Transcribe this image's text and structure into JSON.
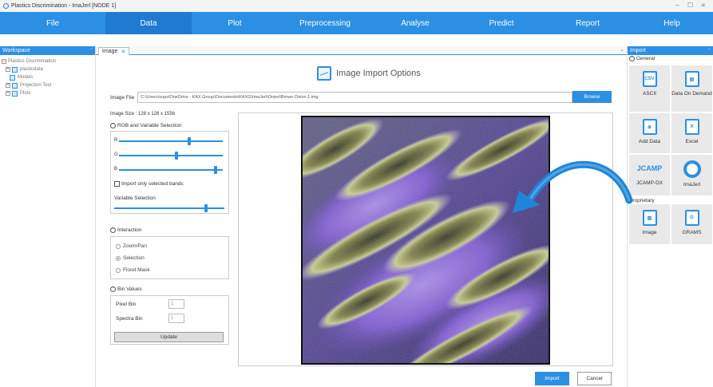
{
  "window": {
    "title": "Plastics Discrimination - ImaJerl [NODE 1]",
    "controls": "– ☐ ≡"
  },
  "menu": [
    {
      "label": "File",
      "active": false
    },
    {
      "label": "Data",
      "active": true
    },
    {
      "label": "Plot",
      "active": false
    },
    {
      "label": "Preprocessing",
      "active": false
    },
    {
      "label": "Analyse",
      "active": false
    },
    {
      "label": "Predict",
      "active": false
    },
    {
      "label": "Report",
      "active": false
    },
    {
      "label": "Help",
      "active": false
    }
  ],
  "workspace": {
    "title": "Workspace",
    "pin": "–",
    "tree": [
      {
        "label": "Plastics Discrimination",
        "expander": "–",
        "indent": 0
      },
      {
        "label": "plasticdata",
        "expander": "+",
        "indent": 1
      },
      {
        "label": "Models",
        "expander": "",
        "indent": 2
      },
      {
        "label": "Projection Test",
        "expander": "+",
        "indent": 1
      },
      {
        "label": "Plots",
        "expander": "+",
        "indent": 1
      }
    ]
  },
  "tab": {
    "label": "Image",
    "close": "✕",
    "chevron": "⌄"
  },
  "dialog": {
    "title": "Image Import Options",
    "file_label": "Image File",
    "file_path": "C:\\Users\\sups\\OneDrive - KAX Group\\Documents\\KAXG\\ImaJerl\\Onion\\Brown Onion.1.img",
    "browse_label": "Browse",
    "image_size": "Image Size : 128 x 128 x 1556",
    "rgb_section": "RGB and Variable Selection",
    "sliders": [
      {
        "label": "R",
        "value": 0.68
      },
      {
        "label": "G",
        "value": 0.55
      },
      {
        "label": "B",
        "value": 0.93
      }
    ],
    "only_selected_label": "Import only selected bands",
    "variable_selection_label": "Variable Selection",
    "variable_value": 0.83,
    "interaction_section": "Interaction",
    "interaction_options": [
      {
        "label": "Zoom/Pan",
        "selected": false
      },
      {
        "label": "Selection",
        "selected": true
      },
      {
        "label": "Flood Mask",
        "selected": false
      }
    ],
    "bin_section": "Bin Values",
    "pixel_bin_label": "Pixel Bin",
    "pixel_bin_value": "1",
    "spectra_bin_label": "Spectra Bin",
    "spectra_bin_value": "1",
    "update_label": "Update",
    "import_label": "Import",
    "cancel_label": "Cancel"
  },
  "import_panel": {
    "title": "Import",
    "pin": "–",
    "general_label": "General",
    "proprietary_label": "Proprietary",
    "general_tiles": [
      {
        "label": "ASCII",
        "icon": "ascii-file-icon",
        "glyph": "CSV"
      },
      {
        "label": "Data On Demand",
        "icon": "data-on-demand-icon",
        "glyph": "▤"
      },
      {
        "label": "Add Data",
        "icon": "add-data-icon",
        "glyph": "⊕"
      },
      {
        "label": "Excel",
        "icon": "excel-icon",
        "glyph": "X"
      },
      {
        "label": "JCAMP-DX",
        "icon": "jcamp-icon",
        "glyph": "JCAMP"
      },
      {
        "label": "ImaJerl",
        "icon": "imajerl-icon",
        "glyph": ""
      }
    ],
    "proprietary_tiles": [
      {
        "label": "Image",
        "icon": "image-icon",
        "glyph": "▨"
      },
      {
        "label": "GRAMS",
        "icon": "grams-icon",
        "glyph": "G"
      }
    ]
  },
  "colors": {
    "accent": "#2b8fe3",
    "menu_active": "#1f7ad0",
    "tile_bg": "#e9e9e9"
  }
}
